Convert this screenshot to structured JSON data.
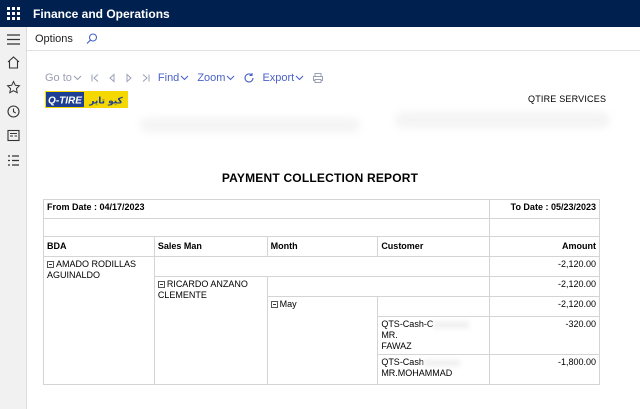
{
  "app": {
    "title": "Finance and Operations"
  },
  "actionbar": {
    "options_label": "Options"
  },
  "left_nav": [
    "hamburger-icon",
    "home-icon",
    "star-icon",
    "clock-icon",
    "workspace-icon",
    "list-icon"
  ],
  "report_toolbar": {
    "goto_label": "Go to",
    "find_label": "Find",
    "zoom_label": "Zoom",
    "export_label": "Export"
  },
  "report": {
    "logo_text": "Q-TIRE",
    "logo_arabic": "كيو تاير",
    "company_name": "QTIRE  SERVICES",
    "title": "PAYMENT COLLECTION REPORT",
    "from_date_label": "From Date  : 04/17/2023",
    "to_date_label": "To Date  : 05/23/2023",
    "columns": {
      "bda": "BDA",
      "sales_man": "Sales Man",
      "month": "Month",
      "customer": "Customer",
      "amount": "Amount"
    },
    "bda_name": "AMADO RODILLAS AGUINALDO",
    "bda_amount": "-2,120.00",
    "sales_man_name": "RICARDO ANZANO CLEMENTE",
    "sales_man_amount": "-2,120.00",
    "month_name": "May",
    "month_amount": "-2,120.00",
    "customers": [
      {
        "line1": "QTS-Cash-C",
        "line1_tail": "MR.",
        "line2": "FAWAZ",
        "amount": "-320.00"
      },
      {
        "line1": "QTS-Cash",
        "line1_tail": "",
        "line2": "MR.MOHAMMAD",
        "amount": "-1,800.00"
      }
    ]
  },
  "colors": {
    "topbar": "#002050",
    "link": "#4a62c8",
    "disabled": "#9aa0b4",
    "logo_yellow": "#f5d800",
    "logo_blue": "#1c3f94"
  }
}
